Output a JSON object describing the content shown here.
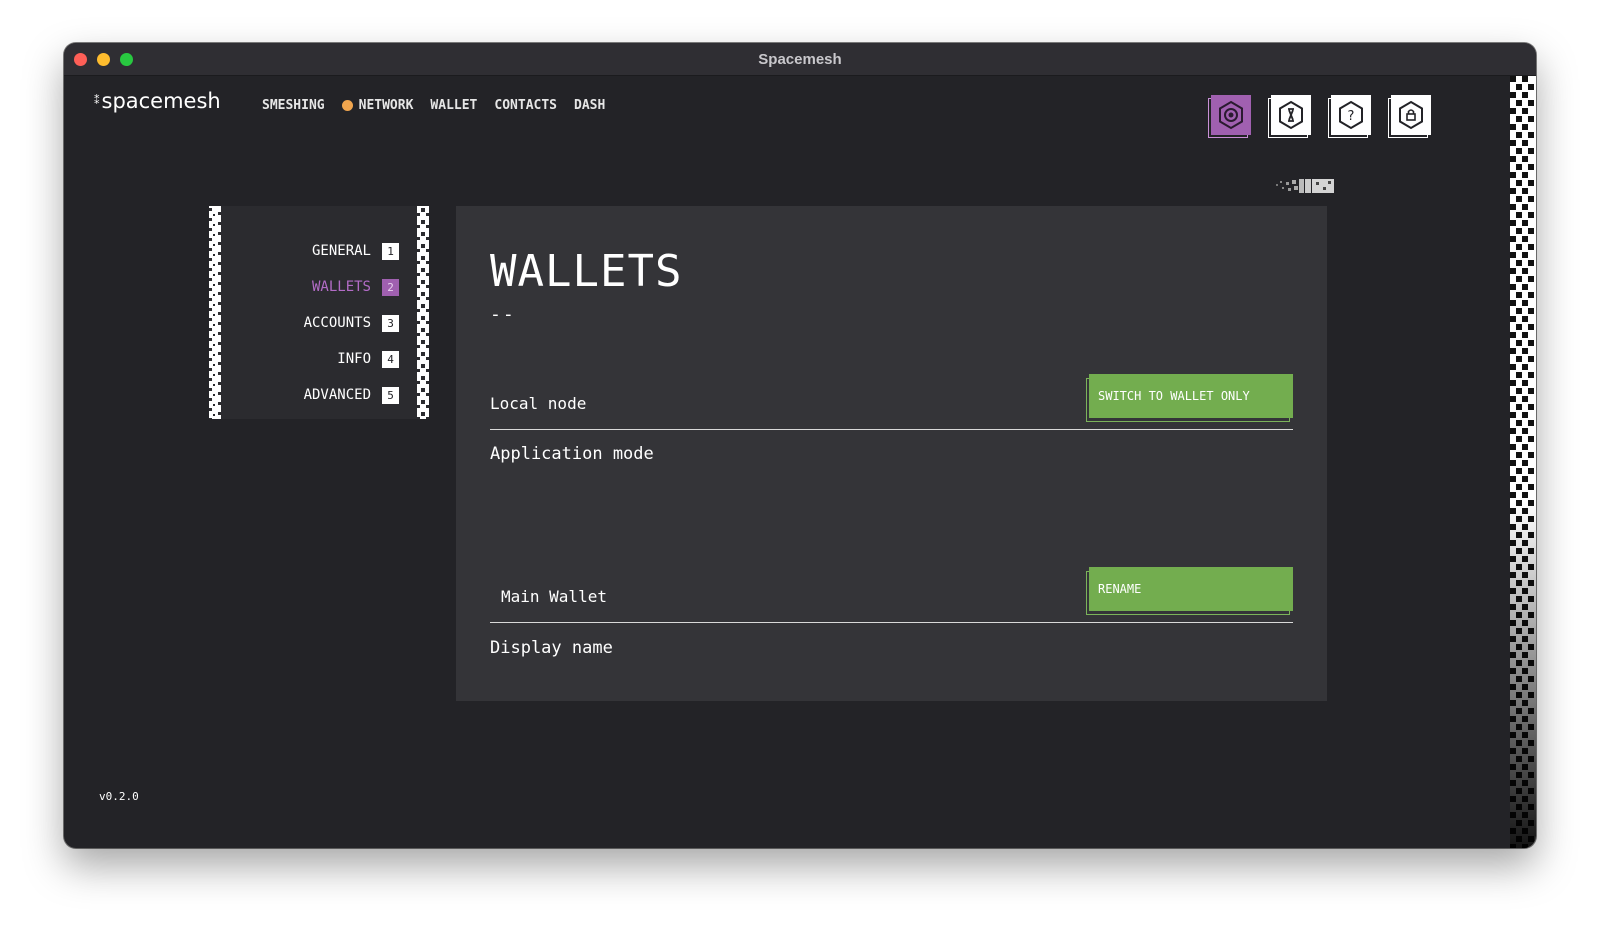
{
  "window": {
    "title": "Spacemesh"
  },
  "logo": {
    "mark": "⁑",
    "text": "spacemesh"
  },
  "nav": {
    "items": [
      {
        "label": "SMESHING"
      },
      {
        "label": "NETWORK",
        "status_color": "#f0a54e"
      },
      {
        "label": "WALLET"
      },
      {
        "label": "CONTACTS"
      },
      {
        "label": "DASH"
      }
    ]
  },
  "top_icons": [
    {
      "name": "settings-icon",
      "active": true
    },
    {
      "name": "wallet-icon",
      "active": false
    },
    {
      "name": "help-icon",
      "active": false
    },
    {
      "name": "lock-icon",
      "active": false
    }
  ],
  "sidemenu": {
    "items": [
      {
        "label": "GENERAL",
        "num": "1"
      },
      {
        "label": "WALLETS",
        "num": "2",
        "active": true
      },
      {
        "label": "ACCOUNTS",
        "num": "3"
      },
      {
        "label": "INFO",
        "num": "4"
      },
      {
        "label": "ADVANCED",
        "num": "5"
      }
    ]
  },
  "content": {
    "title": "WALLETS",
    "subtitle": "--",
    "local_node": {
      "value": "Local node",
      "button": "SWITCH TO WALLET ONLY",
      "label": "Application mode"
    },
    "display_name": {
      "value": "Main Wallet",
      "button": "RENAME",
      "label": "Display name"
    }
  },
  "version": "v0.2.0",
  "colors": {
    "accent": "#a060b0",
    "green": "#73ad4f",
    "background": "#232327",
    "panel": "#343438"
  }
}
